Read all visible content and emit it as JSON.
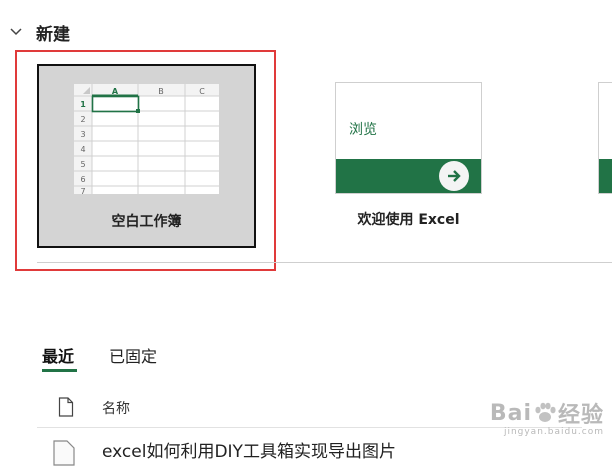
{
  "new_section": {
    "title": "新建",
    "collapse_icon": "chevron-down-icon"
  },
  "templates": [
    {
      "label": "空白工作簿",
      "thumbnail": {
        "columns": [
          "A",
          "B",
          "C"
        ],
        "rows": [
          "1",
          "2",
          "3",
          "4",
          "5",
          "6",
          "7"
        ]
      }
    },
    {
      "label": "欢迎使用 Excel",
      "tile_text": "浏览",
      "icon": "arrow-right-icon"
    }
  ],
  "tabs": {
    "recent": "最近",
    "pinned": "已固定"
  },
  "file_list": {
    "name_header": "名称",
    "header_icon": "file-icon",
    "files": [
      {
        "name": "excel如何利用DIY工具箱实现导出图片",
        "icon": "excel-file-icon"
      }
    ]
  },
  "watermark": {
    "main_left": "Bai",
    "main_right": "经验",
    "sub": "jingyan.baidu.com"
  },
  "colors": {
    "accent_green": "#217346",
    "highlight_red": "#e03a3a",
    "tile_selected_bg": "#d4d4d4"
  }
}
